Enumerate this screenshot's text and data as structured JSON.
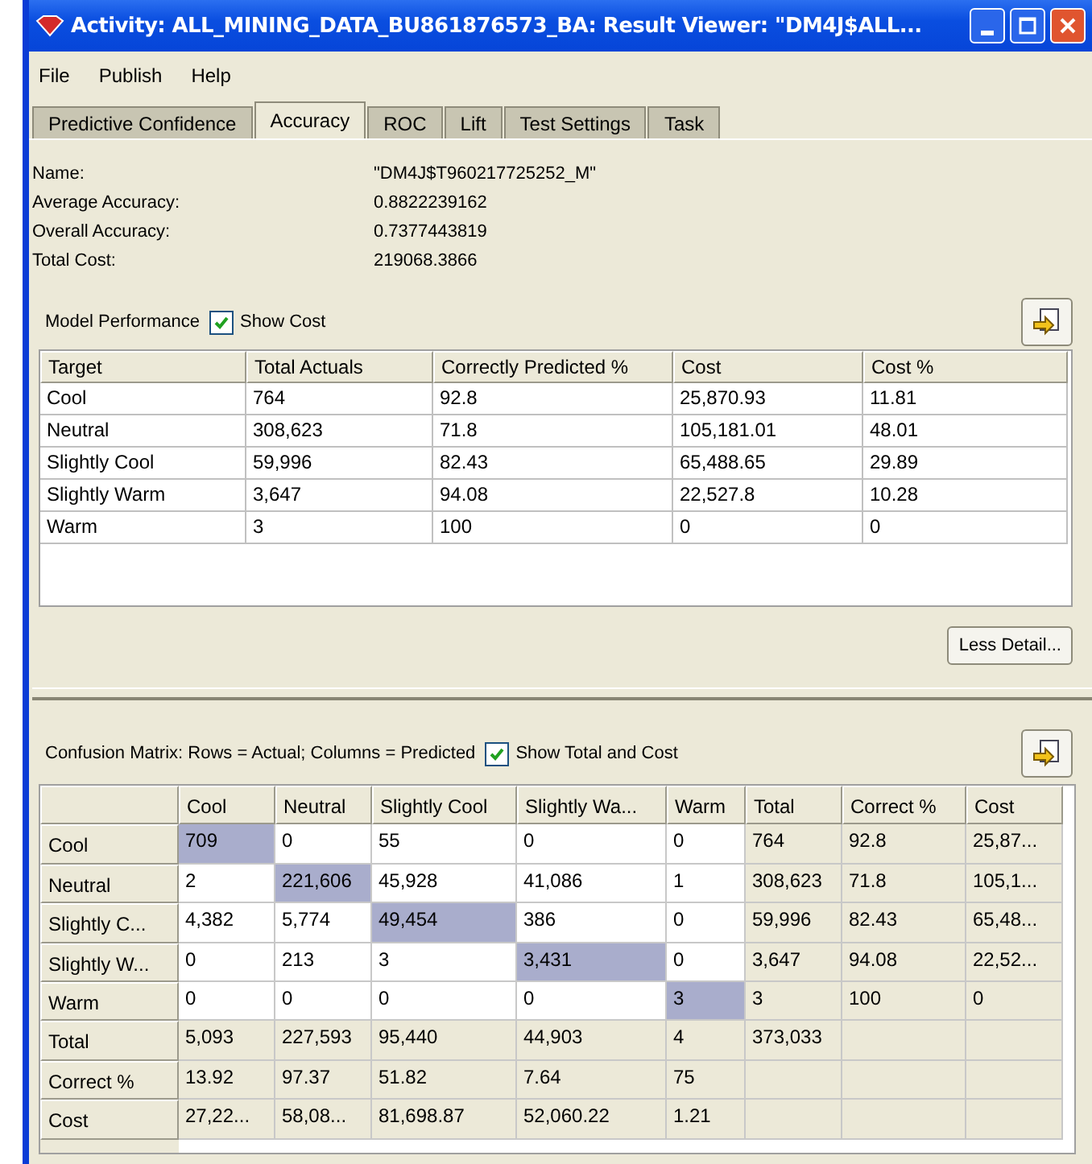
{
  "window": {
    "title": "Activity: ALL_MINING_DATA_BU861876573_BA: Result Viewer: \"DM4J$ALL..."
  },
  "menu": [
    {
      "label": "File"
    },
    {
      "label": "Publish"
    },
    {
      "label": "Help"
    }
  ],
  "tabs": [
    {
      "label": "Predictive Confidence",
      "selected": false
    },
    {
      "label": "Accuracy",
      "selected": true
    },
    {
      "label": "ROC",
      "selected": false
    },
    {
      "label": "Lift",
      "selected": false
    },
    {
      "label": "Test Settings",
      "selected": false
    },
    {
      "label": "Task",
      "selected": false
    }
  ],
  "summary": [
    {
      "label": "Name:",
      "value": "\"DM4J$T960217725252_M\""
    },
    {
      "label": "Average Accuracy:",
      "value": "0.8822239162"
    },
    {
      "label": "Overall Accuracy:",
      "value": "0.7377443819"
    },
    {
      "label": "Total Cost:",
      "value": "219068.3866"
    }
  ],
  "model_performance": {
    "label": "Model Performance",
    "checkbox": {
      "label": "Show Cost",
      "checked": true
    },
    "columns": [
      "Target",
      "Total Actuals",
      "Correctly Predicted %",
      "Cost",
      "Cost %"
    ],
    "rows": [
      [
        "Cool",
        "764",
        "92.8",
        "25,870.93",
        "11.81"
      ],
      [
        "Neutral",
        "308,623",
        "71.8",
        "105,181.01",
        "48.01"
      ],
      [
        "Slightly Cool",
        "59,996",
        "82.43",
        "65,488.65",
        "29.89"
      ],
      [
        "Slightly Warm",
        "3,647",
        "94.08",
        "22,527.8",
        "10.28"
      ],
      [
        "Warm",
        "3",
        "100",
        "0",
        "0"
      ]
    ]
  },
  "less_detail_button": "Less Detail...",
  "confusion_matrix": {
    "label": "Confusion Matrix:  Rows = Actual; Columns = Predicted",
    "checkbox": {
      "label": "Show Total and Cost",
      "checked": true
    },
    "columns": [
      {
        "label": "Cool",
        "kind": "class"
      },
      {
        "label": "Neutral",
        "kind": "class"
      },
      {
        "label": "Slightly Cool",
        "kind": "class"
      },
      {
        "label": "Slightly Wa...",
        "kind": "class"
      },
      {
        "label": "Warm",
        "kind": "class"
      },
      {
        "label": "Total",
        "kind": "summary"
      },
      {
        "label": "Correct %",
        "kind": "summary"
      },
      {
        "label": "Cost",
        "kind": "summary"
      }
    ],
    "rows": [
      {
        "label": "Cool",
        "kind": "class",
        "cells": [
          "709",
          "0",
          "55",
          "0",
          "0",
          "764",
          "92.8",
          "25,87..."
        ]
      },
      {
        "label": "Neutral",
        "kind": "class",
        "cells": [
          "2",
          "221,606",
          "45,928",
          "41,086",
          "1",
          "308,623",
          "71.8",
          "105,1..."
        ]
      },
      {
        "label": "Slightly C...",
        "kind": "class",
        "cells": [
          "4,382",
          "5,774",
          "49,454",
          "386",
          "0",
          "59,996",
          "82.43",
          "65,48..."
        ]
      },
      {
        "label": "Slightly W...",
        "kind": "class",
        "cells": [
          "0",
          "213",
          "3",
          "3,431",
          "0",
          "3,647",
          "94.08",
          "22,52..."
        ]
      },
      {
        "label": "Warm",
        "kind": "class",
        "cells": [
          "0",
          "0",
          "0",
          "0",
          "3",
          "3",
          "100",
          "0"
        ]
      },
      {
        "label": "Total",
        "kind": "summary",
        "cells": [
          "5,093",
          "227,593",
          "95,440",
          "44,903",
          "4",
          "373,033",
          "",
          ""
        ]
      },
      {
        "label": "Correct %",
        "kind": "summary",
        "cells": [
          "13.92",
          "97.37",
          "51.82",
          "7.64",
          "75",
          "",
          "",
          ""
        ]
      },
      {
        "label": "Cost",
        "kind": "summary",
        "cells": [
          "27,22...",
          "58,08...",
          "81,698.87",
          "52,060.22",
          "1.21",
          "",
          "",
          ""
        ]
      }
    ]
  }
}
